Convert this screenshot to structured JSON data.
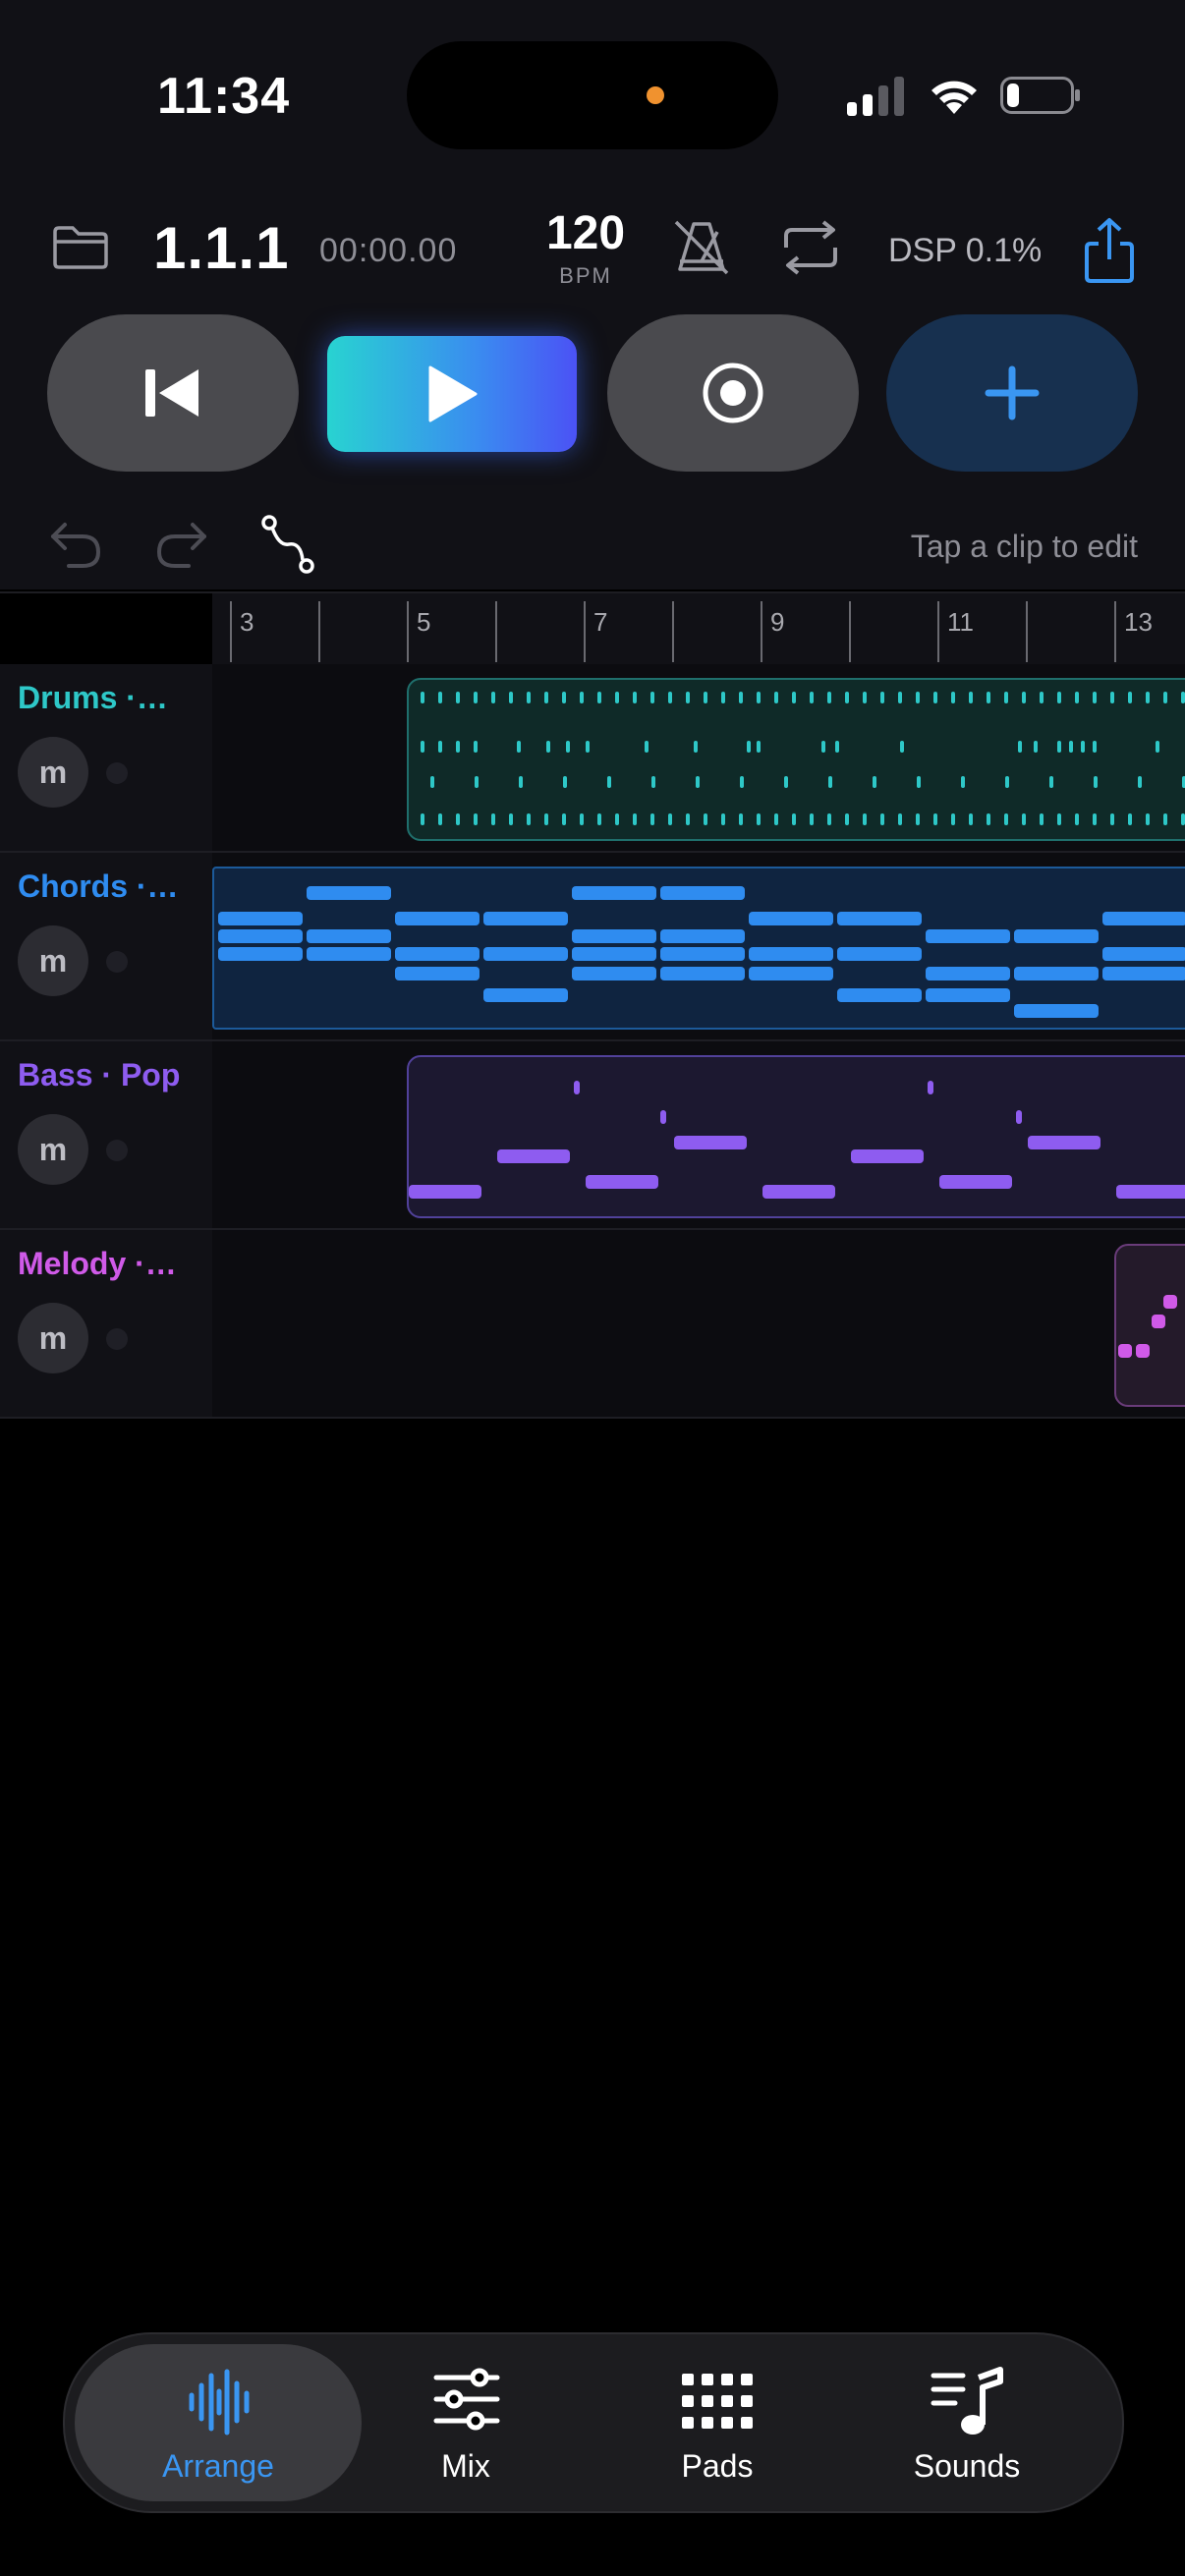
{
  "status": {
    "time": "11:34",
    "battery_color": "#ffffff",
    "camera_indicator_color": "#f0922f"
  },
  "transport": {
    "position": "1.1.1",
    "timecode": "00:00.00",
    "tempo": "120",
    "tempo_unit": "BPM",
    "dsp": "DSP 0.1%",
    "accent_color": "#3a8cf0"
  },
  "controls": {
    "rewind_icon": "skip-back-icon",
    "play_icon": "play-icon",
    "record_icon": "record-icon",
    "add_icon": "plus-icon"
  },
  "edit": {
    "hint": "Tap a clip to edit"
  },
  "ruler": {
    "bars": [
      "3",
      "5",
      "7",
      "9",
      "11",
      "13"
    ]
  },
  "tracks": [
    {
      "name": "Drums ·…",
      "mute_label": "m",
      "color": "#2ec8c8"
    },
    {
      "name": "Chords ·…",
      "mute_label": "m",
      "color": "#2f8cf0"
    },
    {
      "name": "Bass · Pop",
      "mute_label": "m",
      "color": "#8e5cf0"
    },
    {
      "name": "Melody ·…",
      "mute_label": "m",
      "color": "#d05ae8"
    }
  ],
  "tabs": [
    {
      "label": "Arrange",
      "icon": "waveform-icon",
      "active": true,
      "color": "#3a96f2"
    },
    {
      "label": "Mix",
      "icon": "sliders-icon",
      "active": false
    },
    {
      "label": "Pads",
      "icon": "grid-icon",
      "active": false
    },
    {
      "label": "Sounds",
      "icon": "music-note-list-icon",
      "active": false
    }
  ]
}
